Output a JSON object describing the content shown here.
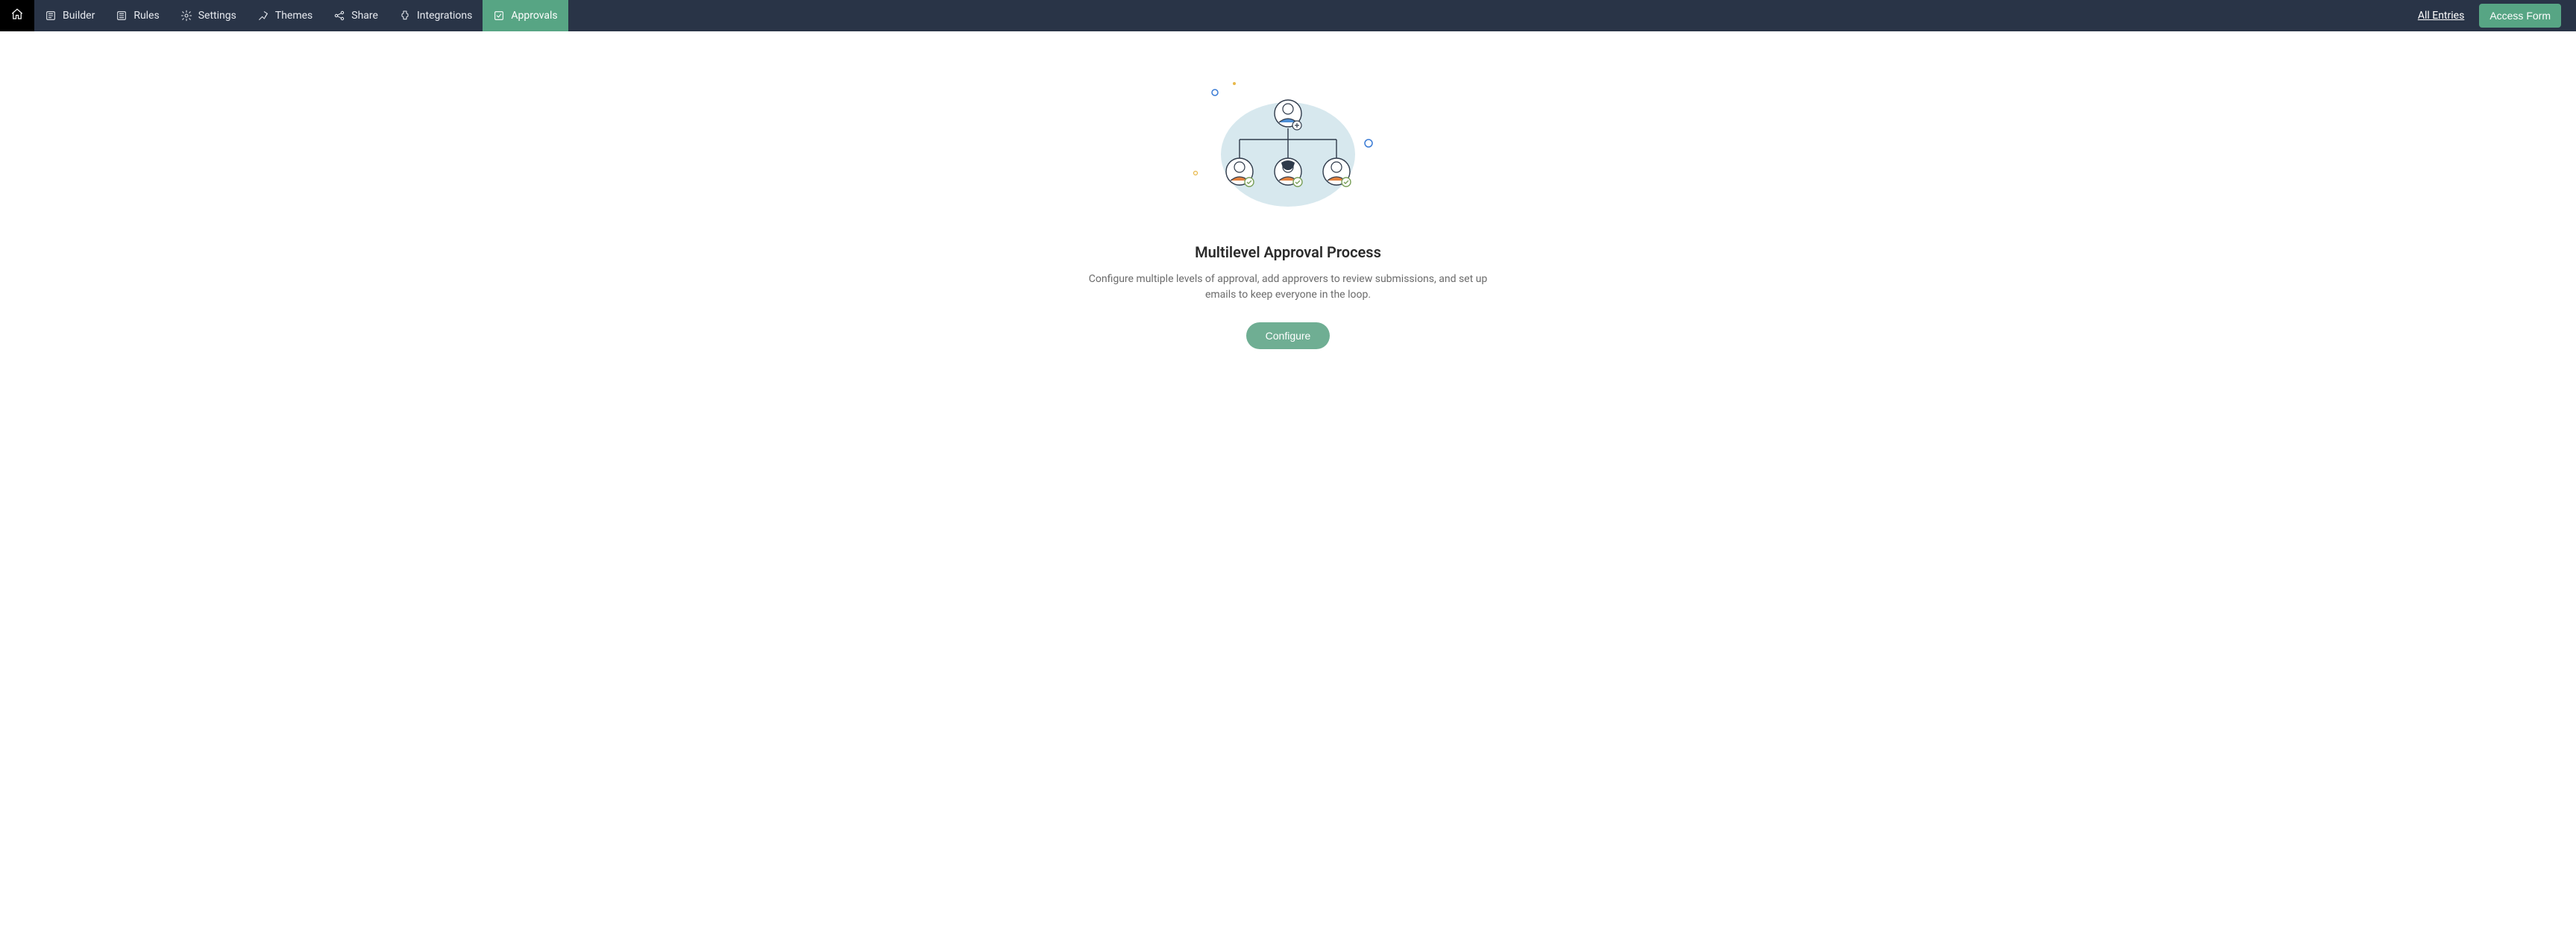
{
  "nav": {
    "tabs": [
      {
        "label": "Builder"
      },
      {
        "label": "Rules"
      },
      {
        "label": "Settings"
      },
      {
        "label": "Themes"
      },
      {
        "label": "Share"
      },
      {
        "label": "Integrations"
      },
      {
        "label": "Approvals"
      }
    ]
  },
  "actions": {
    "all_entries": "All Entries",
    "access_form": "Access Form"
  },
  "empty_state": {
    "title": "Multilevel Approval Process",
    "description": "Configure multiple levels of approval, add approvers to review submissions, and set up emails to keep everyone in the loop.",
    "button": "Configure"
  }
}
